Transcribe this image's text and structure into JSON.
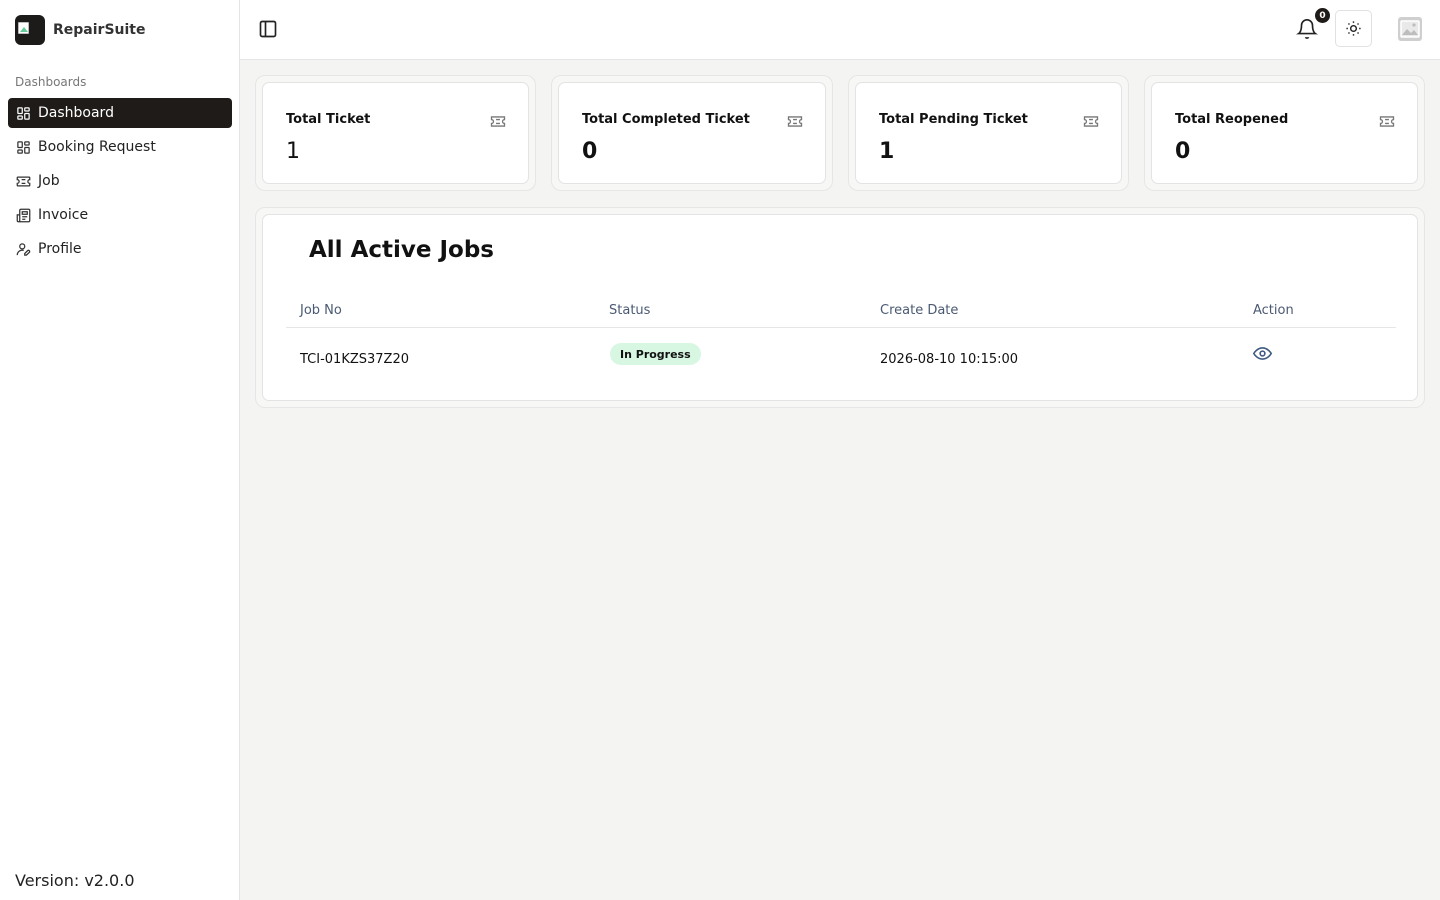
{
  "brand": {
    "name": "RepairSuite"
  },
  "sidebar": {
    "section_label": "Dashboards",
    "items": [
      {
        "label": "Dashboard",
        "icon": "dashboard-grid-icon",
        "active": true
      },
      {
        "label": "Booking Request",
        "icon": "dashboard-grid-icon",
        "active": false
      },
      {
        "label": "Job",
        "icon": "ticket-icon",
        "active": false
      },
      {
        "label": "Invoice",
        "icon": "newspaper-icon",
        "active": false
      },
      {
        "label": "Profile",
        "icon": "user-pen-icon",
        "active": false
      }
    ],
    "version": "Version: v2.0.0"
  },
  "header": {
    "notification_count": "0",
    "icons": [
      "sidebar-toggle-icon",
      "bell-icon",
      "sun-icon",
      "avatar-image-icon"
    ]
  },
  "stats": [
    {
      "title": "Total Ticket",
      "value": "1"
    },
    {
      "title": "Total Completed Ticket",
      "value": "0"
    },
    {
      "title": "Total Pending Ticket",
      "value": "1"
    },
    {
      "title": "Total Reopened",
      "value": "0"
    }
  ],
  "jobs": {
    "title": "All Active Jobs",
    "columns": [
      "Job No",
      "Status",
      "Create Date",
      "Action"
    ],
    "rows": [
      {
        "job_no": "TCI-01KZS37Z20",
        "status": "In Progress",
        "create_date": "2026-08-10 10:15:00",
        "action_icon": "eye-icon"
      }
    ]
  },
  "colors": {
    "active_nav_bg": "#1f1b18",
    "status_in_progress_bg": "#d8f7e2",
    "page_bg": "#f4f4f3"
  }
}
